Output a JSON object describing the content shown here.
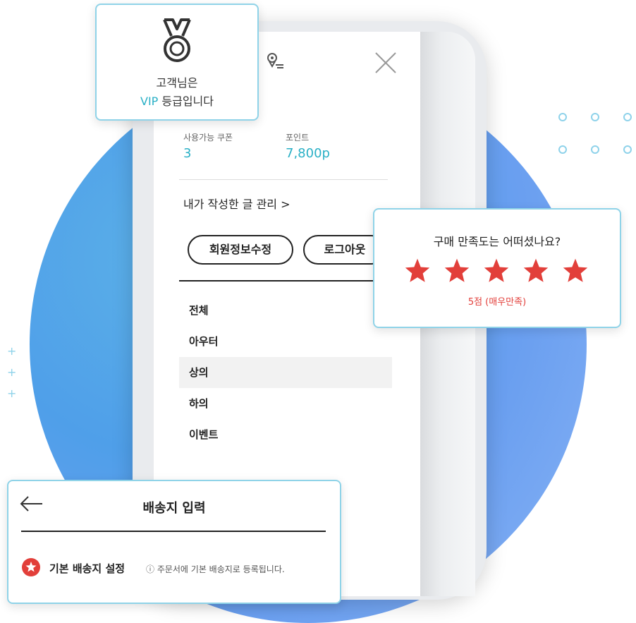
{
  "vip_card": {
    "icon": "medal-icon",
    "line1": "고객님은",
    "vip_word": "VIP",
    "line2_rest": " 등급입니다"
  },
  "menu_panel": {
    "icons": [
      "location-icon",
      "close-icon"
    ],
    "coupon_label": "사용가능 쿠폰",
    "coupon_value": "3",
    "point_label": "포인트",
    "point_value": "7,800p",
    "manage_link": "내가 작성한 글 관리 >",
    "buttons": {
      "edit_profile": "회원정보수정",
      "logout": "로그아웃"
    },
    "categories": [
      {
        "label": "전체"
      },
      {
        "label": "아우터"
      },
      {
        "label": "상의",
        "active": true
      },
      {
        "label": "하의"
      },
      {
        "label": "이벤트"
      }
    ]
  },
  "rating_card": {
    "question": "구매 만족도는 어떠셨나요?",
    "stars": 5,
    "max_stars": 5,
    "score_text": "5점 (매우만족)",
    "star_color": "#e23f3a"
  },
  "address_card": {
    "title": "배송지 입력",
    "default_label": "기본 배송지 설정",
    "note": "ⓘ 주문서에 기본 배송지로 등록됩니다."
  },
  "colors": {
    "accent": "#2ab0c6",
    "card_border": "#8fd3e8",
    "circle": "#4f9fe9",
    "star": "#e23f3a"
  }
}
